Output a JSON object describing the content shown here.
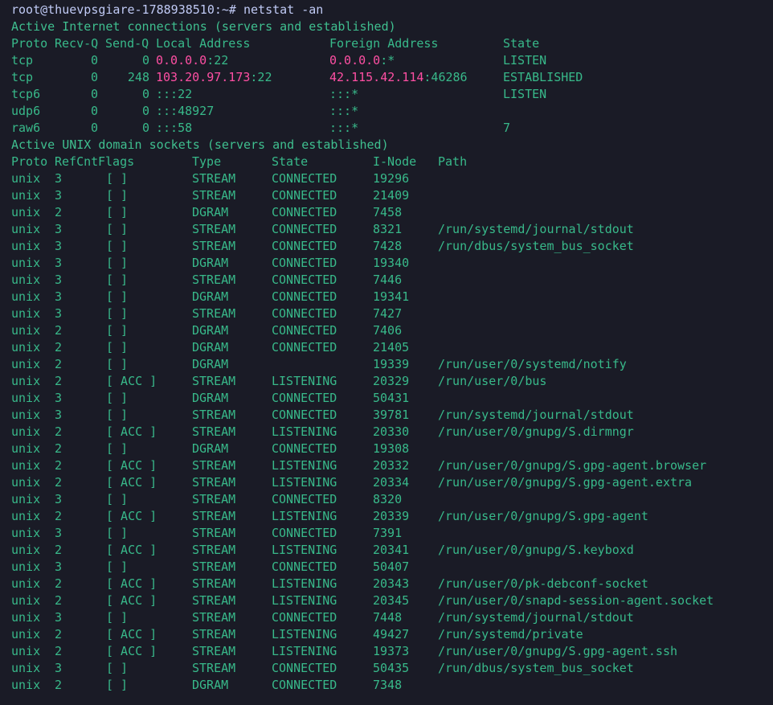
{
  "terminal": {
    "prompt_line": "root@thuevpsgiare-1788938510:~# netstat -an",
    "internet_header": "Active Internet connections (servers and established)",
    "internet_columns": {
      "proto": "Proto",
      "recvq": "Recv-Q",
      "sendq": "Send-Q",
      "local": "Local Address",
      "foreign": "Foreign Address",
      "state": "State"
    },
    "internet_rows": [
      {
        "proto": "tcp",
        "recvq": "0",
        "sendq": "0",
        "local_addr": "0.0.0.0",
        "local_port": ":22",
        "foreign_addr": "0.0.0.0",
        "foreign_port": ":*",
        "state": "LISTEN"
      },
      {
        "proto": "tcp",
        "recvq": "0",
        "sendq": "248",
        "local_addr": "103.20.97.173",
        "local_port": ":22",
        "foreign_addr": "42.115.42.114",
        "foreign_port": ":46286",
        "state": "ESTABLISHED"
      },
      {
        "proto": "tcp6",
        "recvq": "0",
        "sendq": "0",
        "local_addr": "",
        "local_port": ":::22",
        "foreign_addr": "",
        "foreign_port": ":::*",
        "state": "LISTEN"
      },
      {
        "proto": "udp6",
        "recvq": "0",
        "sendq": "0",
        "local_addr": "",
        "local_port": ":::48927",
        "foreign_addr": "",
        "foreign_port": ":::*",
        "state": ""
      },
      {
        "proto": "raw6",
        "recvq": "0",
        "sendq": "0",
        "local_addr": "",
        "local_port": ":::58",
        "foreign_addr": "",
        "foreign_port": ":::*",
        "state": "7"
      }
    ],
    "unix_header": "Active UNIX domain sockets (servers and established)",
    "unix_columns": {
      "proto": "Proto",
      "refcnt": "RefCnt",
      "flags": "Flags",
      "type": "Type",
      "state": "State",
      "inode": "I-Node",
      "path": "Path"
    },
    "unix_rows": [
      {
        "proto": "unix",
        "refcnt": "3",
        "flags": "[ ]",
        "type": "STREAM",
        "state": "CONNECTED",
        "inode": "19296",
        "path": ""
      },
      {
        "proto": "unix",
        "refcnt": "3",
        "flags": "[ ]",
        "type": "STREAM",
        "state": "CONNECTED",
        "inode": "21409",
        "path": ""
      },
      {
        "proto": "unix",
        "refcnt": "2",
        "flags": "[ ]",
        "type": "DGRAM",
        "state": "CONNECTED",
        "inode": "7458",
        "path": ""
      },
      {
        "proto": "unix",
        "refcnt": "3",
        "flags": "[ ]",
        "type": "STREAM",
        "state": "CONNECTED",
        "inode": "8321",
        "path": "/run/systemd/journal/stdout"
      },
      {
        "proto": "unix",
        "refcnt": "3",
        "flags": "[ ]",
        "type": "STREAM",
        "state": "CONNECTED",
        "inode": "7428",
        "path": "/run/dbus/system_bus_socket"
      },
      {
        "proto": "unix",
        "refcnt": "3",
        "flags": "[ ]",
        "type": "DGRAM",
        "state": "CONNECTED",
        "inode": "19340",
        "path": ""
      },
      {
        "proto": "unix",
        "refcnt": "3",
        "flags": "[ ]",
        "type": "STREAM",
        "state": "CONNECTED",
        "inode": "7446",
        "path": ""
      },
      {
        "proto": "unix",
        "refcnt": "3",
        "flags": "[ ]",
        "type": "DGRAM",
        "state": "CONNECTED",
        "inode": "19341",
        "path": ""
      },
      {
        "proto": "unix",
        "refcnt": "3",
        "flags": "[ ]",
        "type": "STREAM",
        "state": "CONNECTED",
        "inode": "7427",
        "path": ""
      },
      {
        "proto": "unix",
        "refcnt": "2",
        "flags": "[ ]",
        "type": "DGRAM",
        "state": "CONNECTED",
        "inode": "7406",
        "path": ""
      },
      {
        "proto": "unix",
        "refcnt": "2",
        "flags": "[ ]",
        "type": "DGRAM",
        "state": "CONNECTED",
        "inode": "21405",
        "path": ""
      },
      {
        "proto": "unix",
        "refcnt": "2",
        "flags": "[ ]",
        "type": "DGRAM",
        "state": "",
        "inode": "19339",
        "path": "/run/user/0/systemd/notify"
      },
      {
        "proto": "unix",
        "refcnt": "2",
        "flags": "[ ACC ]",
        "type": "STREAM",
        "state": "LISTENING",
        "inode": "20329",
        "path": "/run/user/0/bus"
      },
      {
        "proto": "unix",
        "refcnt": "3",
        "flags": "[ ]",
        "type": "DGRAM",
        "state": "CONNECTED",
        "inode": "50431",
        "path": ""
      },
      {
        "proto": "unix",
        "refcnt": "3",
        "flags": "[ ]",
        "type": "STREAM",
        "state": "CONNECTED",
        "inode": "39781",
        "path": "/run/systemd/journal/stdout"
      },
      {
        "proto": "unix",
        "refcnt": "2",
        "flags": "[ ACC ]",
        "type": "STREAM",
        "state": "LISTENING",
        "inode": "20330",
        "path": "/run/user/0/gnupg/S.dirmngr"
      },
      {
        "proto": "unix",
        "refcnt": "2",
        "flags": "[ ]",
        "type": "DGRAM",
        "state": "CONNECTED",
        "inode": "19308",
        "path": ""
      },
      {
        "proto": "unix",
        "refcnt": "2",
        "flags": "[ ACC ]",
        "type": "STREAM",
        "state": "LISTENING",
        "inode": "20332",
        "path": "/run/user/0/gnupg/S.gpg-agent.browser"
      },
      {
        "proto": "unix",
        "refcnt": "2",
        "flags": "[ ACC ]",
        "type": "STREAM",
        "state": "LISTENING",
        "inode": "20334",
        "path": "/run/user/0/gnupg/S.gpg-agent.extra"
      },
      {
        "proto": "unix",
        "refcnt": "3",
        "flags": "[ ]",
        "type": "STREAM",
        "state": "CONNECTED",
        "inode": "8320",
        "path": ""
      },
      {
        "proto": "unix",
        "refcnt": "2",
        "flags": "[ ACC ]",
        "type": "STREAM",
        "state": "LISTENING",
        "inode": "20339",
        "path": "/run/user/0/gnupg/S.gpg-agent"
      },
      {
        "proto": "unix",
        "refcnt": "3",
        "flags": "[ ]",
        "type": "STREAM",
        "state": "CONNECTED",
        "inode": "7391",
        "path": ""
      },
      {
        "proto": "unix",
        "refcnt": "2",
        "flags": "[ ACC ]",
        "type": "STREAM",
        "state": "LISTENING",
        "inode": "20341",
        "path": "/run/user/0/gnupg/S.keyboxd"
      },
      {
        "proto": "unix",
        "refcnt": "3",
        "flags": "[ ]",
        "type": "STREAM",
        "state": "CONNECTED",
        "inode": "50407",
        "path": ""
      },
      {
        "proto": "unix",
        "refcnt": "2",
        "flags": "[ ACC ]",
        "type": "STREAM",
        "state": "LISTENING",
        "inode": "20343",
        "path": "/run/user/0/pk-debconf-socket"
      },
      {
        "proto": "unix",
        "refcnt": "2",
        "flags": "[ ACC ]",
        "type": "STREAM",
        "state": "LISTENING",
        "inode": "20345",
        "path": "/run/user/0/snapd-session-agent.socket"
      },
      {
        "proto": "unix",
        "refcnt": "3",
        "flags": "[ ]",
        "type": "STREAM",
        "state": "CONNECTED",
        "inode": "7448",
        "path": "/run/systemd/journal/stdout"
      },
      {
        "proto": "unix",
        "refcnt": "2",
        "flags": "[ ACC ]",
        "type": "STREAM",
        "state": "LISTENING",
        "inode": "49427",
        "path": "/run/systemd/private"
      },
      {
        "proto": "unix",
        "refcnt": "2",
        "flags": "[ ACC ]",
        "type": "STREAM",
        "state": "LISTENING",
        "inode": "19373",
        "path": "/run/user/0/gnupg/S.gpg-agent.ssh"
      },
      {
        "proto": "unix",
        "refcnt": "3",
        "flags": "[ ]",
        "type": "STREAM",
        "state": "CONNECTED",
        "inode": "50435",
        "path": "/run/dbus/system_bus_socket"
      },
      {
        "proto": "unix",
        "refcnt": "2",
        "flags": "[ ]",
        "type": "DGRAM",
        "state": "CONNECTED",
        "inode": "7348",
        "path": ""
      }
    ]
  },
  "colors": {
    "background": "#1a1b26",
    "text": "#38b98a",
    "prompt": "#c0caf5",
    "address_highlight": "#ff4fa3"
  }
}
